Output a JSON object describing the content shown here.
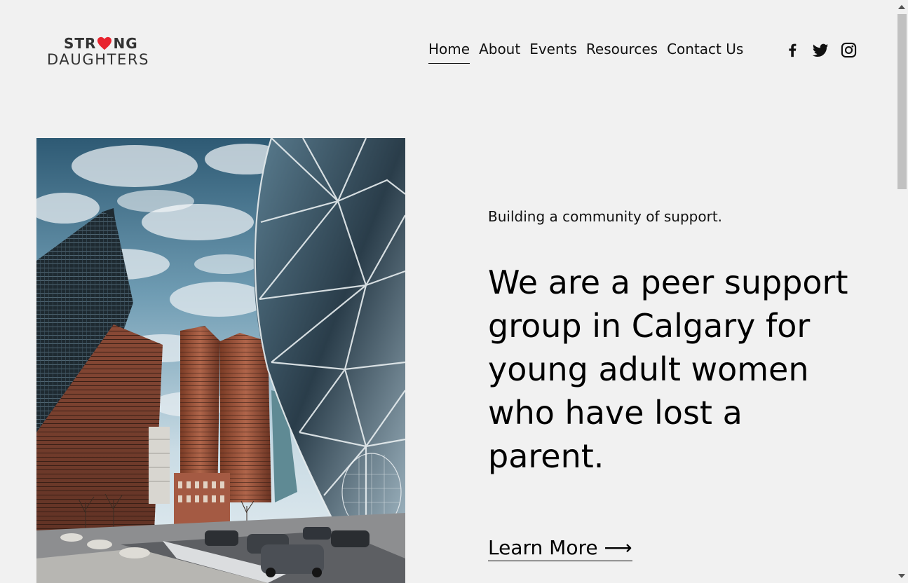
{
  "logo": {
    "line1_left": "STR",
    "line1_right": "NG",
    "line2": "DAUGHTERS",
    "heart_color": "#e8232e"
  },
  "nav": {
    "items": [
      {
        "label": "Home",
        "active": true
      },
      {
        "label": "About",
        "active": false
      },
      {
        "label": "Events",
        "active": false
      },
      {
        "label": "Resources",
        "active": false
      },
      {
        "label": "Contact Us",
        "active": false
      }
    ]
  },
  "social": {
    "icons": [
      "facebook-icon",
      "twitter-icon",
      "instagram-icon"
    ]
  },
  "hero": {
    "tagline": "Building a community of support.",
    "headline": "We are a peer support group in Calgary for young adult women who have lost a parent.",
    "cta_label": "Learn More ⟶"
  },
  "colors": {
    "background": "#f1f1f1",
    "text": "#000000",
    "accent": "#e8232e"
  }
}
